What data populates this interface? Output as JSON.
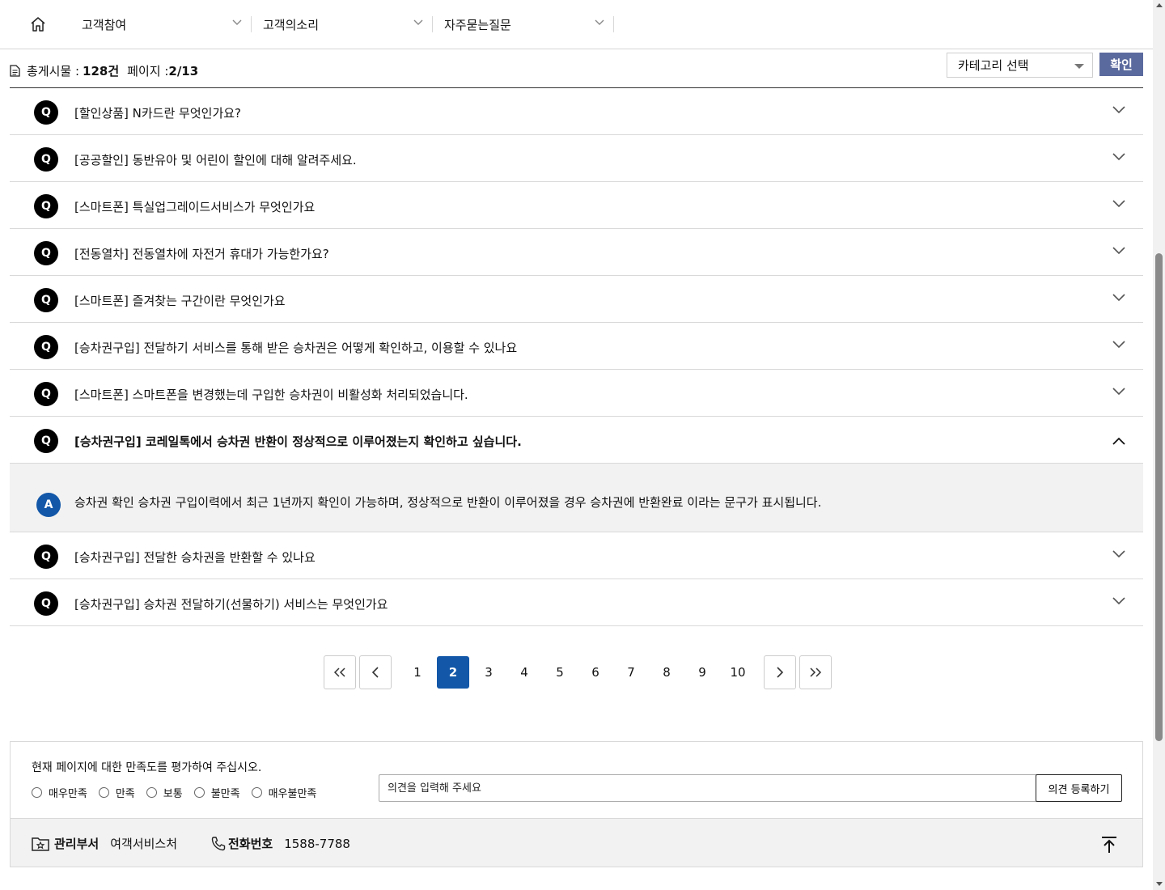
{
  "nav": {
    "home_icon": "home-icon",
    "items": [
      {
        "label": "고객참여"
      },
      {
        "label": "고객의소리"
      },
      {
        "label": "자주묻는질문"
      }
    ]
  },
  "info": {
    "total_label": "총게시물 :",
    "total_value": "128건",
    "page_label": "페이지 :",
    "page_value": "2/13",
    "category_select": "카테고리 선택",
    "confirm": "확인"
  },
  "faq": {
    "q_badge": "Q",
    "a_badge": "A",
    "items": [
      {
        "question": "[할인상품] N카드란 무엇인가요?"
      },
      {
        "question": "[공공할인] 동반유아 및 어린이 할인에 대해 알려주세요."
      },
      {
        "question": "[스마트폰] 특실업그레이드서비스가 무엇인가요"
      },
      {
        "question": "[전동열차] 전동열차에 자전거 휴대가 가능한가요?"
      },
      {
        "question": "[스마트폰] 즐겨찾는 구간이란 무엇인가요"
      },
      {
        "question": "[승차권구입] 전달하기 서비스를 통해 받은 승차권은 어떻게 확인하고, 이용할 수 있나요"
      },
      {
        "question": "[스마트폰] 스마트폰을 변경했는데 구입한 승차권이 비활성화 처리되었습니다."
      },
      {
        "question": "[승차권구입] 코레일톡에서 승차권 반환이 정상적으로 이루어졌는지 확인하고 싶습니다.",
        "answer": "승차권 확인 승차권 구입이력에서 최근 1년까지 확인이 가능하며, 정상적으로 반환이 이루어졌을 경우 승차권에 반환완료 이라는 문구가 표시됩니다."
      },
      {
        "question": "[승차권구입] 전달한 승차권을 반환할 수 있나요"
      },
      {
        "question": "[승차권구입] 승차권 전달하기(선물하기) 서비스는 무엇인가요"
      }
    ]
  },
  "pagination": {
    "pages": [
      "1",
      "2",
      "3",
      "4",
      "5",
      "6",
      "7",
      "8",
      "9",
      "10"
    ],
    "current": "2"
  },
  "survey": {
    "title": "현재 페이지에 대한 만족도를 평가하여 주십시오.",
    "options": [
      "매우만족",
      "만족",
      "보통",
      "불만족",
      "매우불만족"
    ],
    "placeholder": "의견을 입력해 주세요",
    "submit": "의견 등록하기"
  },
  "footer": {
    "dept_label": "관리부서",
    "dept_value": "여객서비스처",
    "tel_label": "전화번호",
    "tel_value": "1588-7788"
  },
  "colors": {
    "accent_blue": "#1257a8",
    "confirm_button": "#5b6a9e",
    "answer_bg": "#f2f2f2"
  }
}
